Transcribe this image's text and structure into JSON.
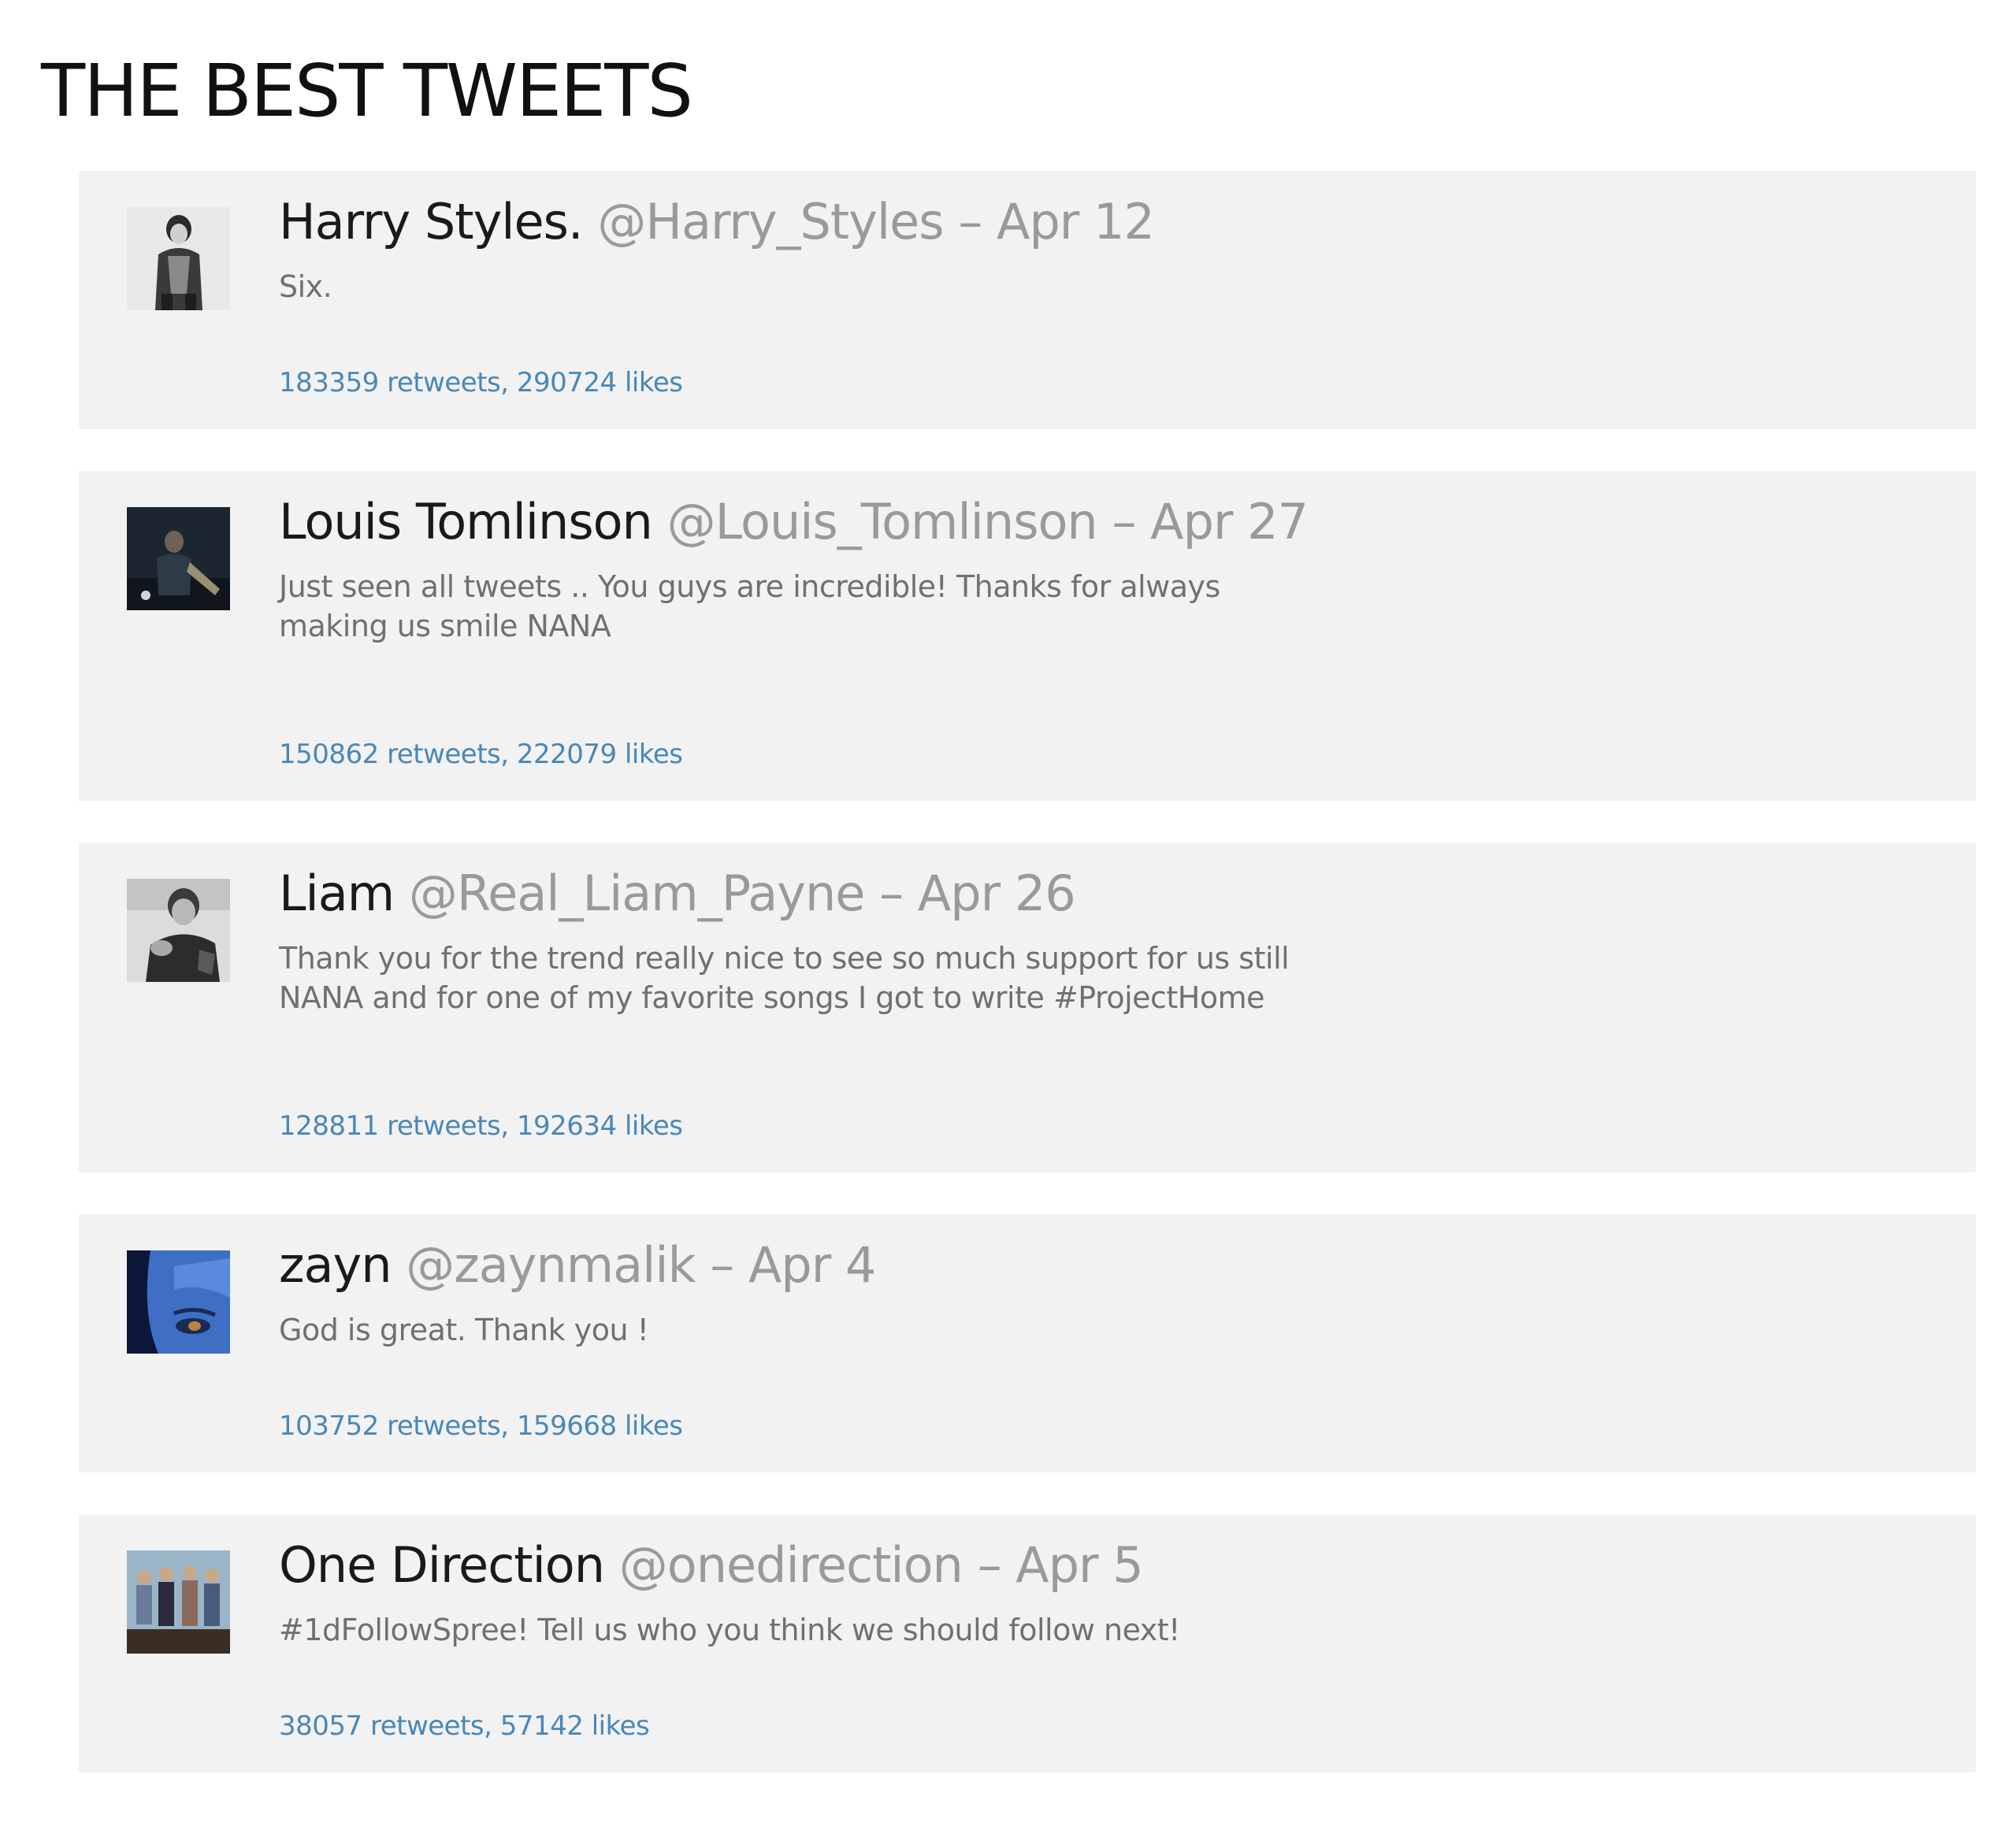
{
  "page": {
    "title": "THE BEST TWEETS"
  },
  "tweets": [
    {
      "name": "Harry Styles.",
      "handle": "@Harry_Styles",
      "separator": "–",
      "date": "Apr 12",
      "text": "Six.",
      "stats": "183359 retweets, 290724 likes",
      "avatar": "profile photo"
    },
    {
      "name": "Louis Tomlinson",
      "handle": "@Louis_Tomlinson",
      "separator": "–",
      "date": "Apr 27",
      "text": "Just seen all tweets .. You guys are incredible! Thanks for always making us smile NANA",
      "stats": "150862 retweets, 222079 likes",
      "avatar": "profile photo"
    },
    {
      "name": "Liam",
      "handle": "@Real_Liam_Payne",
      "separator": "–",
      "date": "Apr 26",
      "text": "Thank you for the trend really nice to see so much support for us still NANA and for one of my favorite songs I got to write #ProjectHome",
      "stats": "128811 retweets, 192634 likes",
      "avatar": "profile photo"
    },
    {
      "name": "zayn",
      "handle": "@zaynmalik",
      "separator": "–",
      "date": "Apr 4",
      "text": "God is great. Thank you !",
      "stats": "103752 retweets, 159668 likes",
      "avatar": "profile photo"
    },
    {
      "name": "One Direction",
      "handle": "@onedirection",
      "separator": "–",
      "date": "Apr 5",
      "text": "#1dFollowSpree! Tell us who you think we should follow next!",
      "stats": "38057 retweets, 57142 likes",
      "avatar": "profile photo"
    }
  ],
  "colors": {
    "card_background": "#f2f2f2",
    "stats_link": "#4a87b8",
    "muted_text": "#9a9a9a",
    "name_text": "#1a1a1a"
  }
}
